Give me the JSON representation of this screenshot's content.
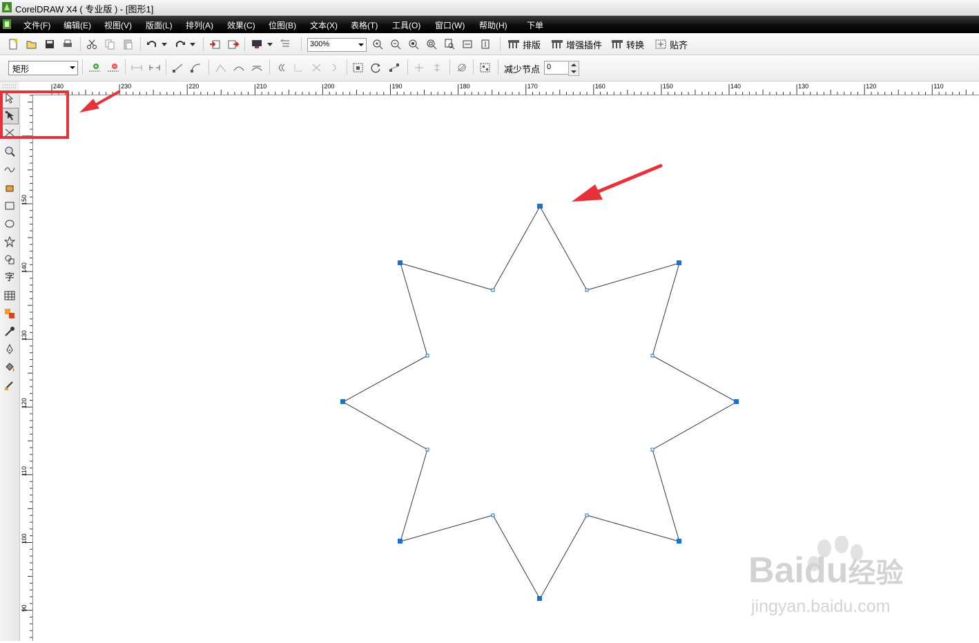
{
  "window": {
    "title": "CorelDRAW X4 ( 专业版 ) - [图形1]"
  },
  "menu": [
    {
      "label": "文件(F)"
    },
    {
      "label": "编辑(E)"
    },
    {
      "label": "视图(V)"
    },
    {
      "label": "版面(L)"
    },
    {
      "label": "排列(A)"
    },
    {
      "label": "效果(C)"
    },
    {
      "label": "位图(B)"
    },
    {
      "label": "文本(X)"
    },
    {
      "label": "表格(T)"
    },
    {
      "label": "工具(O)"
    },
    {
      "label": "窗口(W)"
    },
    {
      "label": "帮助(H)"
    },
    {
      "label": "下单"
    }
  ],
  "toolbar": {
    "zoom_value": "300%",
    "plugins": [
      {
        "label": "排版",
        "icon": "layout-plugin-icon"
      },
      {
        "label": "增强插件",
        "icon": "enhance-plugin-icon"
      },
      {
        "label": "转换",
        "icon": "convert-plugin-icon"
      },
      {
        "label": "贴齐",
        "icon": "snap-icon"
      }
    ]
  },
  "property_bar": {
    "shape_select": "矩形",
    "reduce_nodes_label": "减少节点",
    "reduce_nodes_value": "0"
  },
  "rulers": {
    "horizontal_ticks": [
      "240",
      "230",
      "220",
      "210",
      "200",
      "190",
      "180",
      "170",
      "160",
      "150",
      "140",
      "130",
      "120",
      "110"
    ],
    "vertical_ticks": [
      "150",
      "140",
      "130",
      "120",
      "110",
      "100",
      "90"
    ]
  },
  "toolbox_icons": [
    "pick-tool-icon",
    "shape-tool-icon",
    "crop-tool-icon",
    "zoom-tool-icon",
    "freehand-tool-icon",
    "smart-fill-tool-icon",
    "rectangle-tool-icon",
    "ellipse-tool-icon",
    "star-tool-icon",
    "basic-shapes-tool-icon",
    "text-tool-icon",
    "table-tool-icon",
    "interactive-blend-tool-icon",
    "eyedropper-tool-icon",
    "outline-pen-tool-icon",
    "fill-tool-icon",
    "interactive-fill-tool-icon"
  ],
  "watermark": {
    "brand": "Baidu",
    "brand_cn": "经验",
    "url": "jingyan.baidu.com"
  },
  "colors": {
    "menubar_bg": "#000000",
    "selection_node": "#1a73c9",
    "annotation_red": "#e8323a",
    "star_outline": "#3a3050"
  }
}
